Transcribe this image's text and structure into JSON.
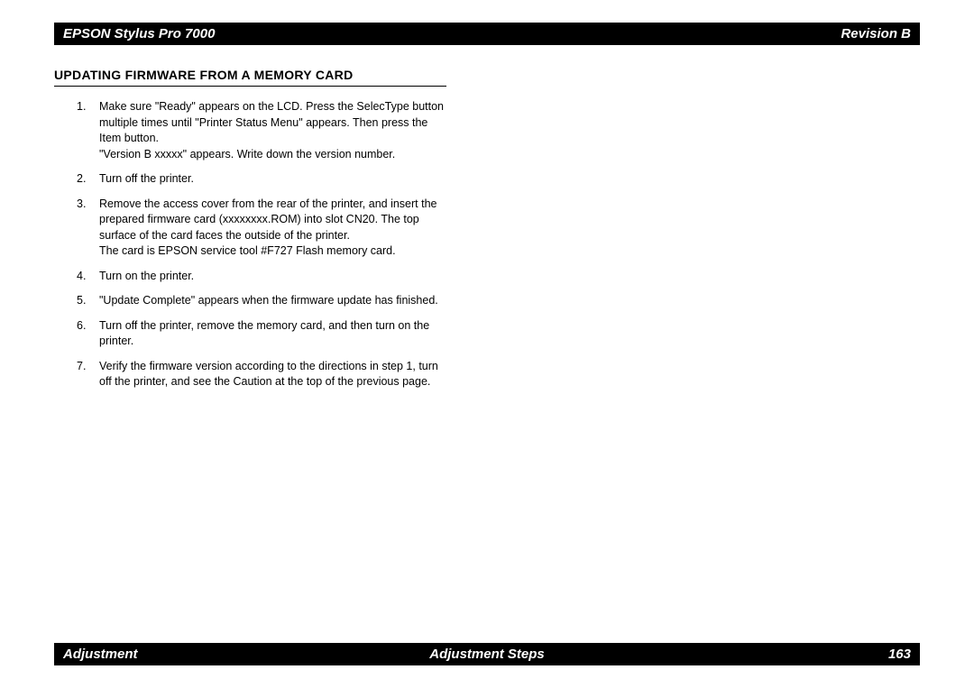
{
  "header": {
    "left": "EPSON Stylus Pro 7000",
    "right": "Revision B"
  },
  "section": {
    "title": "UPDATING FIRMWARE FROM A MEMORY CARD"
  },
  "steps": [
    "Make sure \"Ready\" appears on the LCD. Press the SelecType button multiple times until \"Printer Status Menu\" appears. Then press the Item button.\n\"Version B xxxxx\" appears. Write down the version number.",
    "Turn off the printer.",
    "Remove the access cover from the rear of the printer, and insert the prepared firmware card (xxxxxxxx.ROM) into slot CN20. The top surface of the card faces the outside of the printer.\nThe card is EPSON service tool #F727 Flash memory card.",
    "Turn on the printer.",
    "\"Update Complete\" appears when the firmware update has finished.",
    "Turn off the printer, remove the memory card, and then turn on the printer.",
    "Verify the firmware version according to the directions in step 1, turn off the printer, and see the Caution at the top of the previous page."
  ],
  "footer": {
    "left": "Adjustment",
    "center": "Adjustment Steps",
    "right": "163"
  }
}
